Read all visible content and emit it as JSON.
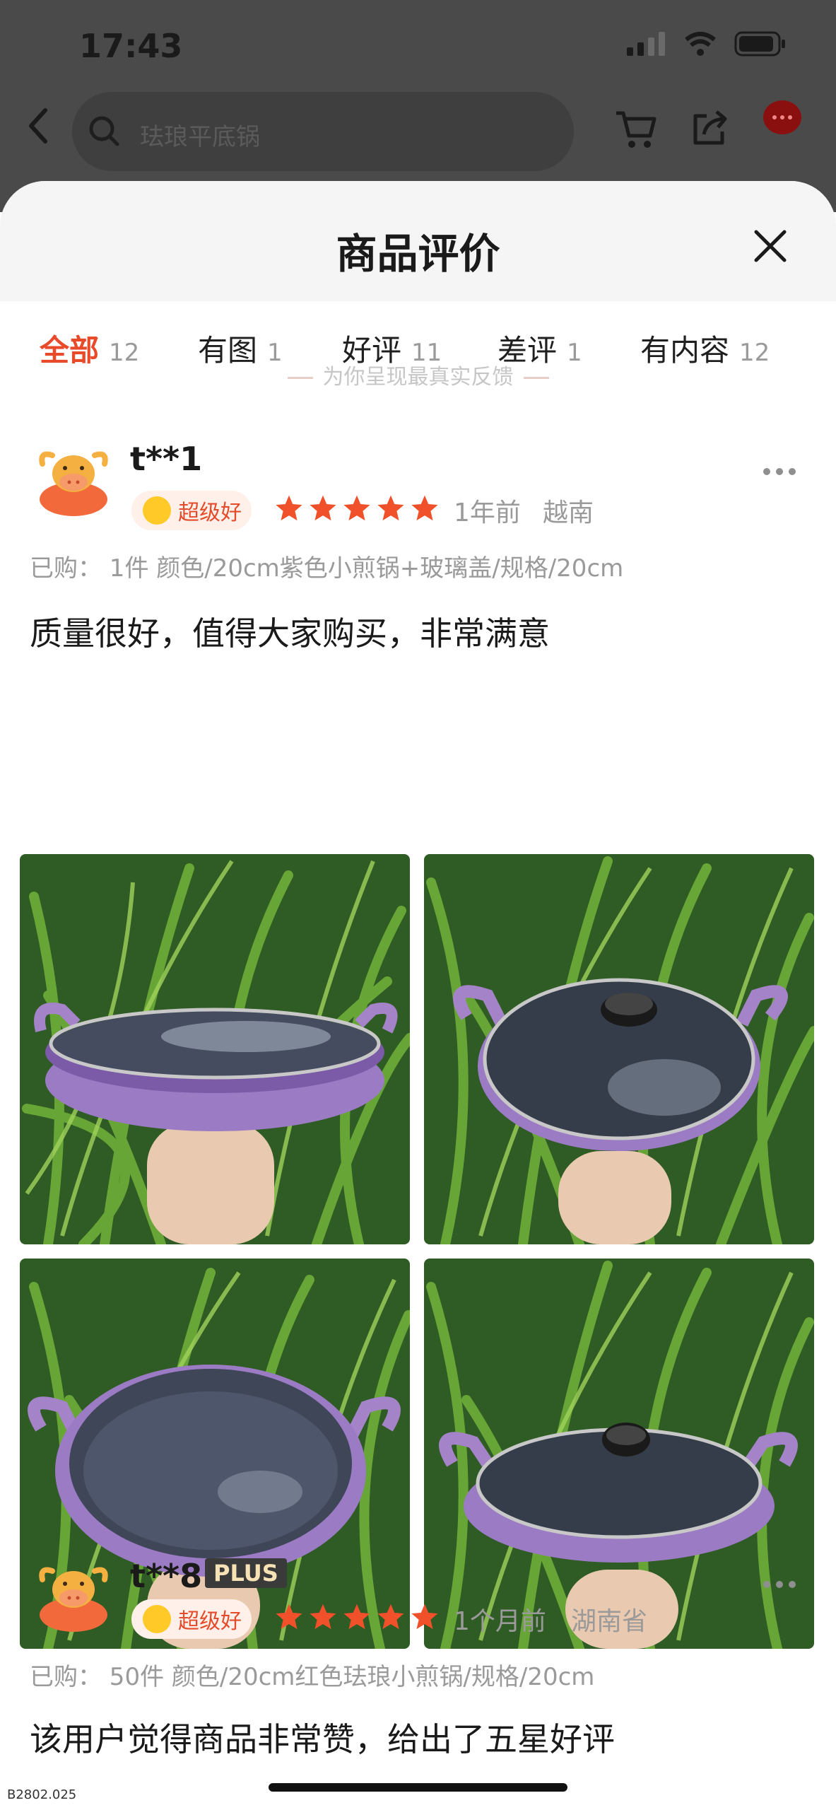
{
  "status_bar": {
    "time": "17:43"
  },
  "search": {
    "placeholder": "珐琅平底锅"
  },
  "sheet": {
    "title": "商品评价",
    "tabs": [
      {
        "label": "全部",
        "count": "12",
        "active": true
      },
      {
        "label": "有图",
        "count": "1"
      },
      {
        "label": "好评",
        "count": "11"
      },
      {
        "label": "差评",
        "count": "1"
      },
      {
        "label": "有内容",
        "count": "12"
      }
    ],
    "notice": "为你呈现最真实反馈"
  },
  "reviews": [
    {
      "username": "t**1",
      "badge": "超级好",
      "stars": 5,
      "time": "1年前",
      "location": "越南",
      "purchase": "已购：  1件  颜色/20cm紫色小煎锅+玻璃盖/规格/20cm",
      "text": "质量很好，值得大家购买，非常满意",
      "photo_count": 4
    },
    {
      "username": "t**8",
      "member_badge": "PLUS",
      "badge": "超级好",
      "stars": 5,
      "time": "1个月前",
      "location": "湖南省",
      "purchase": "已购：  50件  颜色/20cm红色珐琅小煎锅/规格/20cm",
      "text": "该用户觉得商品非常赞，给出了五星好评"
    }
  ],
  "footer": {
    "watermark": "B2802.025"
  },
  "colors": {
    "accent": "#e84a2a",
    "star": "#f0512b",
    "pan": "#9b7bc4"
  },
  "icons": [
    "back-icon",
    "search-icon",
    "cart-icon",
    "share-icon",
    "message-icon",
    "close-icon",
    "more-icon",
    "star-icon"
  ]
}
